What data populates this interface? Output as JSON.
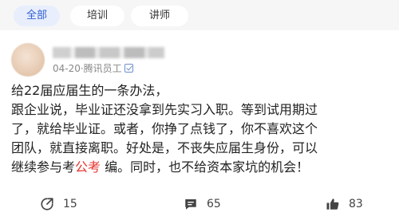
{
  "tabs": [
    {
      "label": "全部",
      "active": true
    },
    {
      "label": "培训",
      "active": false
    },
    {
      "label": "讲师",
      "active": false
    }
  ],
  "post": {
    "author_meta": "04-20·腾讯员工",
    "content": {
      "line1": "给22届应届生的一条办法，",
      "line2": "跟企业说，毕业证还没拿到先实习入职。等到试用期过",
      "line3": "了，就给毕业证。或者，你挣了点钱了，你不喜欢这个",
      "line4": "团队，就直接离职。好处是，不丧失应届生身份，可以",
      "line5_before": "继续参与考",
      "line5_keyword": "公考",
      "line5_after": " 编。同时，也不给资本家坑的机会！"
    },
    "actions": {
      "share_count": "15",
      "comment_count": "65",
      "like_count": "83"
    }
  },
  "colors": {
    "accent": "#2d5fd3",
    "keyword": "#e5332e",
    "tab_bar_bg": "#f6f6f7"
  },
  "icons": {
    "share": "share-icon",
    "comment": "comment-icon",
    "like": "thumbs-up-icon",
    "verified": "verified-badge-icon"
  }
}
